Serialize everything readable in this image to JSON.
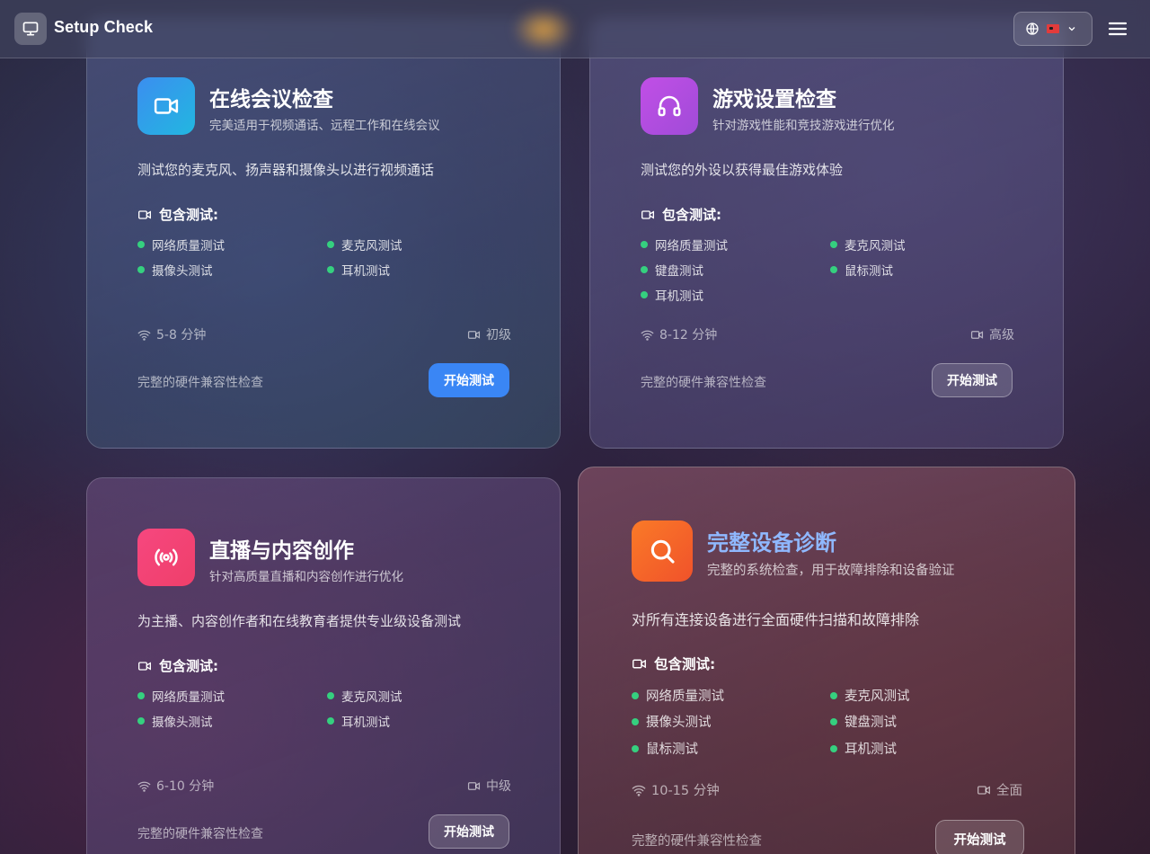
{
  "header": {
    "app_title": "Setup Check",
    "language_flag": "cn-flag-icon"
  },
  "colors": {
    "accent_blue": "#3a86f5",
    "dot_green": "#35d07f",
    "video_tile": "#2ba3e8",
    "gaming_tile": "#b34ee0",
    "streaming_tile": "#f24a79",
    "diagnostic_tile": "#f56024",
    "diagnostic_title": "#8fb8ff"
  },
  "cards": [
    {
      "title": "在线会议检查",
      "subtitle": "完美适用于视频通话、远程工作和在线会议",
      "description": "测试您的麦克风、扬声器和摄像头以进行视频通话",
      "tests_heading": "包含测试:",
      "tests": [
        "网络质量测试",
        "麦克风测试",
        "摄像头测试",
        "耳机测试"
      ],
      "duration": "5-8 分钟",
      "level": "初级",
      "footnote": "完整的硬件兼容性检查",
      "button": "开始测试"
    },
    {
      "title": "游戏设置检查",
      "subtitle": "针对游戏性能和竞技游戏进行优化",
      "description": "测试您的外设以获得最佳游戏体验",
      "tests_heading": "包含测试:",
      "tests": [
        "网络质量测试",
        "麦克风测试",
        "键盘测试",
        "鼠标测试",
        "耳机测试"
      ],
      "duration": "8-12 分钟",
      "level": "高级",
      "footnote": "完整的硬件兼容性检查",
      "button": "开始测试"
    },
    {
      "title": "直播与内容创作",
      "subtitle": "针对高质量直播和内容创作进行优化",
      "description": "为主播、内容创作者和在线教育者提供专业级设备测试",
      "tests_heading": "包含测试:",
      "tests": [
        "网络质量测试",
        "麦克风测试",
        "摄像头测试",
        "耳机测试"
      ],
      "duration": "6-10 分钟",
      "level": "中级",
      "footnote": "完整的硬件兼容性检查",
      "button": "开始测试"
    },
    {
      "title": "完整设备诊断",
      "subtitle": "完整的系统检查，用于故障排除和设备验证",
      "description": "对所有连接设备进行全面硬件扫描和故障排除",
      "tests_heading": "包含测试:",
      "tests": [
        "网络质量测试",
        "麦克风测试",
        "摄像头测试",
        "键盘测试",
        "鼠标测试",
        "耳机测试"
      ],
      "duration": "10-15 分钟",
      "level": "全面",
      "footnote": "完整的硬件兼容性检查",
      "button": "开始测试"
    }
  ]
}
